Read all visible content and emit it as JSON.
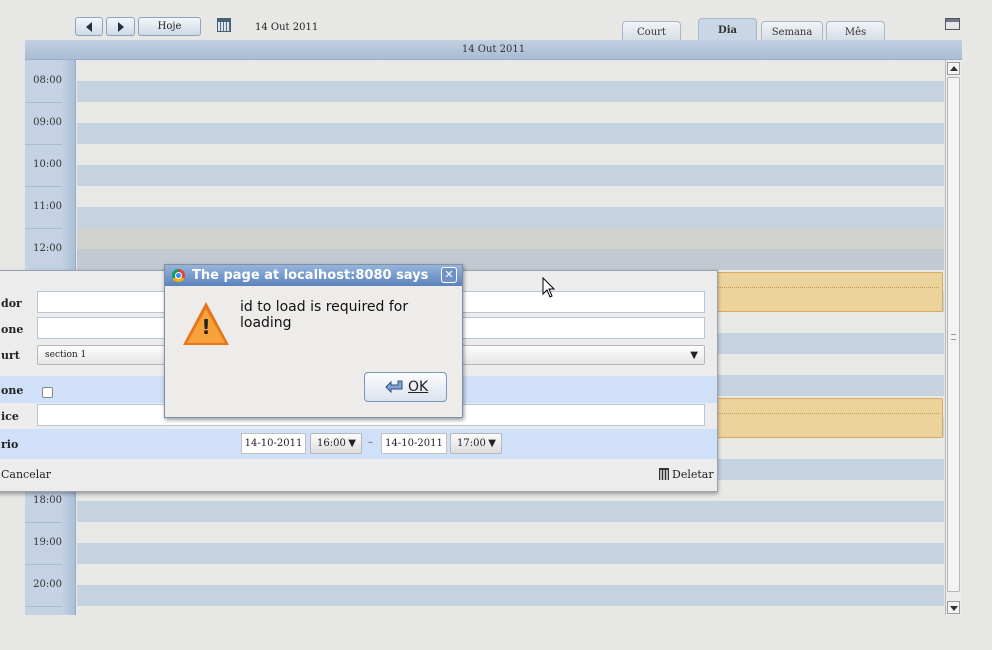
{
  "toolbar": {
    "prev_icon": "triangle-left-icon",
    "next_icon": "triangle-right-icon",
    "today_label": "Hoje",
    "date_text": "14 Out 2011"
  },
  "tabs": [
    {
      "label": "Court",
      "active": false
    },
    {
      "label": "Dia",
      "active": true
    },
    {
      "label": "Semana",
      "active": false
    },
    {
      "label": "Mês",
      "active": false
    }
  ],
  "day_header": "14 Out 2011",
  "hours": [
    "08:00",
    "09:00",
    "10:00",
    "11:00",
    "12:00",
    "18:00",
    "19:00",
    "20:00"
  ],
  "form": {
    "rows": [
      {
        "label": "dor"
      },
      {
        "label": "one"
      },
      {
        "label": "urt",
        "select_value": "section 1"
      },
      {
        "label": "one"
      },
      {
        "label": "ice"
      },
      {
        "label": "rio"
      }
    ],
    "start_date": "14-10-2011",
    "start_time": "16:00",
    "separator": "–",
    "end_date": "14-10-2011",
    "end_time": "17:00",
    "cancel_label": "Cancelar",
    "delete_label": "Deletar"
  },
  "dialog": {
    "title": "The page at localhost:8080 says",
    "message": "id to load is required for loading",
    "ok_label": "OK",
    "close_glyph": "✕"
  },
  "colors": {
    "accent": "#5b83bb",
    "event_fill": "#ecd29b",
    "warning": "#e8741d"
  }
}
